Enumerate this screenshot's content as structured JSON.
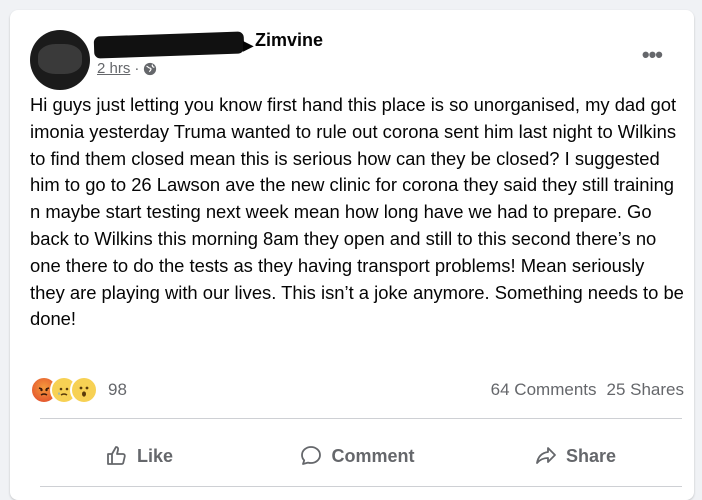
{
  "post": {
    "group_name": "Zimvine",
    "timestamp": "2 hrs",
    "separator": "·",
    "body": "Hi guys just letting you know first hand this place is so unorganised, my dad got imonia yesterday Truma wanted to rule out corona sent him last night to Wilkins to find them closed mean this is serious how can they be closed? I suggested him to go to 26 Lawson ave the new clinic for corona they said they still training n maybe start testing next week mean how long have we had to prepare. Go back to Wilkins this morning 8am they open and still to this second there’s no one there to do the tests as they having transport problems! Mean seriously they are playing with our lives. This isn’t a joke anymore. Something needs to be done!"
  },
  "stats": {
    "reaction_count": "98",
    "comments": "64 Comments",
    "shares": "25 Shares",
    "reactions": [
      "angry-emoji",
      "sad-emoji",
      "wow-emoji"
    ]
  },
  "actions": {
    "like": "Like",
    "comment": "Comment",
    "share": "Share"
  },
  "colors": {
    "secondary_text": "#65676b",
    "divider": "#ced0d4"
  }
}
